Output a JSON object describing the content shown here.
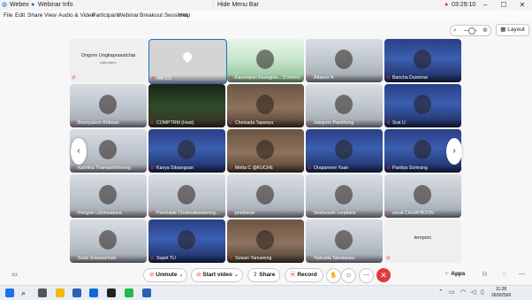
{
  "titlebar": {
    "app": "Webex",
    "webinar_info": "Webinar Info",
    "hide_menu": "Hide Menu Bar",
    "timer": "03:29:10"
  },
  "menu": [
    "File",
    "Edit",
    "Share",
    "View",
    "Audio & Video",
    "Participant",
    "Webinar",
    "Breakout Sessions",
    "Help"
  ],
  "top_right": {
    "layout_label": "Layout"
  },
  "participants": [
    {
      "name": "Ongorn Ungkaprasatchai",
      "sub": "(Attendee)",
      "style": "blank"
    },
    {
      "name": "RK-CC",
      "style": "gray"
    },
    {
      "name": "Kasornpas Kaungina... (Cohost)",
      "style": "green"
    },
    {
      "name": "Attawut N",
      "style": "office"
    },
    {
      "name": "Bancha Duonmai",
      "style": "blue"
    },
    {
      "name": "Boonyaluch Kittiwan",
      "style": "office"
    },
    {
      "name": "COMPTRM (Host)",
      "style": "room"
    },
    {
      "name": "Chetsada Tapanya",
      "style": "brown"
    },
    {
      "name": "Jatuporn Pamthong",
      "style": "office"
    },
    {
      "name": "Srat U",
      "style": "blue"
    },
    {
      "name": "Kannika Thampanishvong",
      "style": "office"
    },
    {
      "name": "Kanya Sitsanguan",
      "style": "blue"
    },
    {
      "name": "Metta C @KUCHE",
      "style": "brown"
    },
    {
      "name": "Orapannee Yuan",
      "style": "blue"
    },
    {
      "name": "Panitya Somrang",
      "style": "blue"
    },
    {
      "name": "Pengsiri Udomsatana",
      "style": "office"
    },
    {
      "name": "Petchalak Chokwattanawong...",
      "style": "office"
    },
    {
      "name": "pnmberat",
      "style": "office"
    },
    {
      "name": "Seelucarth Lerpkeris",
      "style": "office"
    },
    {
      "name": "socat CHUAYBOON",
      "style": "office"
    },
    {
      "name": "Suda Srisuwannak",
      "style": "office"
    },
    {
      "name": "Supet TU",
      "style": "blue"
    },
    {
      "name": "Suwan Yanuwong",
      "style": "brown"
    },
    {
      "name": "Tadsada Taksawasu",
      "style": "office"
    },
    {
      "name": "temporc",
      "style": "blank"
    }
  ],
  "controls": {
    "unmute": "Unmute",
    "start_video": "Start video",
    "share": "Share",
    "record": "Record",
    "apps": "Apps"
  },
  "taskbar": {
    "time": "11:28",
    "date": "26/9/2566"
  },
  "colors": {
    "leave": "#e03a3a",
    "accent": "#1170cf"
  }
}
